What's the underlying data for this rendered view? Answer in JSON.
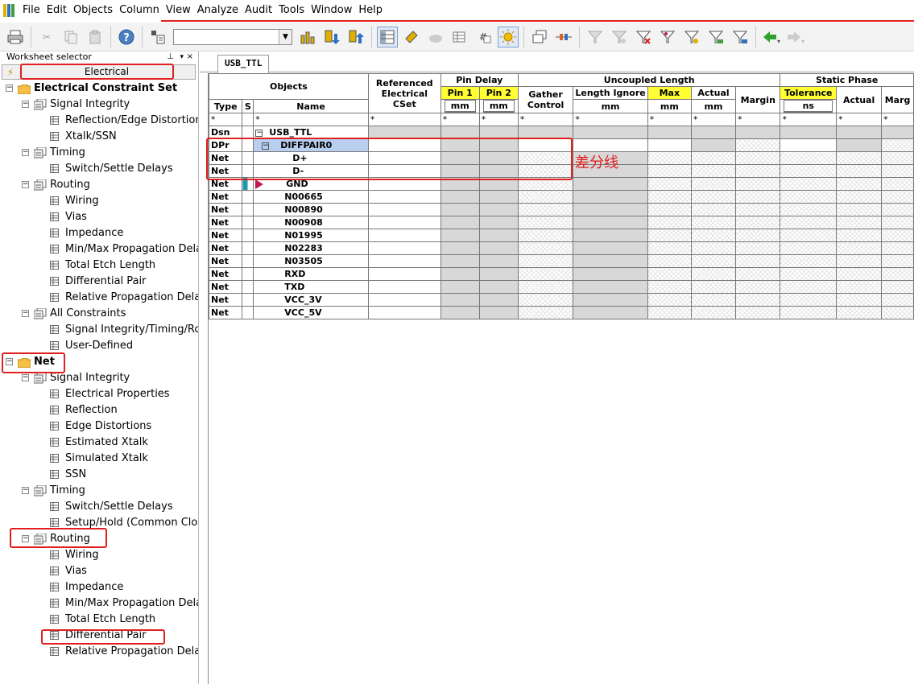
{
  "menu": [
    "File",
    "Edit",
    "Objects",
    "Column",
    "View",
    "Analyze",
    "Audit",
    "Tools",
    "Window",
    "Help"
  ],
  "toolbar": {
    "combo_value": "",
    "buttons": [
      "print-icon",
      "cut-icon",
      "copy-icon",
      "paste-icon",
      "help-icon",
      "net-filter-icon",
      "sort-bars-icon",
      "arrow-down-icon",
      "arrow-up-icon",
      "worksheet-icon",
      "gold-pin-icon",
      "cloud-icon",
      "grid-icon",
      "number-icon",
      "sun-icon",
      "windows-icon",
      "connect-icon",
      "filter-a-icon",
      "filter-b-icon",
      "filter-c-icon",
      "filter-d-icon",
      "filter-e-icon",
      "filter-f-icon",
      "filter-g-icon",
      "back-arrow-icon",
      "forward-arrow-icon"
    ]
  },
  "worksheet_selector": {
    "title": "Worksheet selector",
    "selector_label": "Electrical",
    "tree": [
      {
        "label": "Electrical Constraint Set",
        "level": 0,
        "kind": "folder",
        "bold": true
      },
      {
        "label": "Signal Integrity",
        "level": 1,
        "kind": "sheets"
      },
      {
        "label": "Reflection/Edge Distortions",
        "level": 2,
        "kind": "sheet"
      },
      {
        "label": "Xtalk/SSN",
        "level": 2,
        "kind": "sheet"
      },
      {
        "label": "Timing",
        "level": 1,
        "kind": "sheets"
      },
      {
        "label": "Switch/Settle Delays",
        "level": 2,
        "kind": "sheet"
      },
      {
        "label": "Routing",
        "level": 1,
        "kind": "sheets"
      },
      {
        "label": "Wiring",
        "level": 2,
        "kind": "sheet"
      },
      {
        "label": "Vias",
        "level": 2,
        "kind": "sheet"
      },
      {
        "label": "Impedance",
        "level": 2,
        "kind": "sheet"
      },
      {
        "label": "Min/Max Propagation Delays",
        "level": 2,
        "kind": "sheet"
      },
      {
        "label": "Total Etch Length",
        "level": 2,
        "kind": "sheet"
      },
      {
        "label": "Differential Pair",
        "level": 2,
        "kind": "sheet"
      },
      {
        "label": "Relative Propagation Delay",
        "level": 2,
        "kind": "sheet"
      },
      {
        "label": "All Constraints",
        "level": 1,
        "kind": "sheets"
      },
      {
        "label": "Signal Integrity/Timing/Routing",
        "level": 2,
        "kind": "sheet"
      },
      {
        "label": "User-Defined",
        "level": 2,
        "kind": "sheet"
      },
      {
        "label": "Net",
        "level": 0,
        "kind": "folder",
        "bold": true
      },
      {
        "label": "Signal Integrity",
        "level": 1,
        "kind": "sheets"
      },
      {
        "label": "Electrical Properties",
        "level": 2,
        "kind": "sheet"
      },
      {
        "label": "Reflection",
        "level": 2,
        "kind": "sheet"
      },
      {
        "label": "Edge Distortions",
        "level": 2,
        "kind": "sheet"
      },
      {
        "label": "Estimated Xtalk",
        "level": 2,
        "kind": "sheet"
      },
      {
        "label": "Simulated Xtalk",
        "level": 2,
        "kind": "sheet"
      },
      {
        "label": "SSN",
        "level": 2,
        "kind": "sheet"
      },
      {
        "label": "Timing",
        "level": 1,
        "kind": "sheets"
      },
      {
        "label": "Switch/Settle Delays",
        "level": 2,
        "kind": "sheet"
      },
      {
        "label": "Setup/Hold (Common Clock)",
        "level": 2,
        "kind": "sheet"
      },
      {
        "label": "Routing",
        "level": 1,
        "kind": "sheets"
      },
      {
        "label": "Wiring",
        "level": 2,
        "kind": "sheet"
      },
      {
        "label": "Vias",
        "level": 2,
        "kind": "sheet"
      },
      {
        "label": "Impedance",
        "level": 2,
        "kind": "sheet"
      },
      {
        "label": "Min/Max Propagation Delays",
        "level": 2,
        "kind": "sheet"
      },
      {
        "label": "Total Etch Length",
        "level": 2,
        "kind": "sheet"
      },
      {
        "label": "Differential Pair",
        "level": 2,
        "kind": "sheet"
      },
      {
        "label": "Relative Propagation Delay",
        "level": 2,
        "kind": "sheet"
      }
    ]
  },
  "tab": {
    "label": "USB_TTL"
  },
  "grid": {
    "headers": {
      "objects": "Objects",
      "referenced": "Referenced Electrical CSet",
      "pin_delay": "Pin Delay",
      "pin1": "Pin 1",
      "pin2": "Pin 2",
      "uncoupled": "Uncoupled Length",
      "gather": "Gather Control",
      "length_ignore": "Length Ignore",
      "max": "Max",
      "actual": "Actual",
      "margin": "Margin",
      "static_phase": "Static Phase",
      "tolerance": "Tolerance",
      "sp_actual": "Actual",
      "sp_margin": "Marg",
      "type": "Type",
      "s": "S",
      "name": "Name"
    },
    "units": {
      "mm": "mm",
      "ns": "ns"
    },
    "filter": "*",
    "rows": [
      {
        "type": "Dsn",
        "name": "USB_TTL"
      },
      {
        "type": "DPr",
        "name": "DIFFPAIR0"
      },
      {
        "type": "Net",
        "name": "D+"
      },
      {
        "type": "Net",
        "name": "D-"
      },
      {
        "type": "Net",
        "name": "GND"
      },
      {
        "type": "Net",
        "name": "N00665"
      },
      {
        "type": "Net",
        "name": "N00890"
      },
      {
        "type": "Net",
        "name": "N00908"
      },
      {
        "type": "Net",
        "name": "N01995"
      },
      {
        "type": "Net",
        "name": "N02283"
      },
      {
        "type": "Net",
        "name": "N03505"
      },
      {
        "type": "Net",
        "name": "RXD"
      },
      {
        "type": "Net",
        "name": "TXD"
      },
      {
        "type": "Net",
        "name": "VCC_3V"
      },
      {
        "type": "Net",
        "name": "VCC_5V"
      }
    ]
  },
  "annotation": {
    "text": "差分线"
  },
  "colors": {
    "highlight_red": "#e02020",
    "yellow_header": "#ffff33",
    "selection": "#b8cff0"
  }
}
